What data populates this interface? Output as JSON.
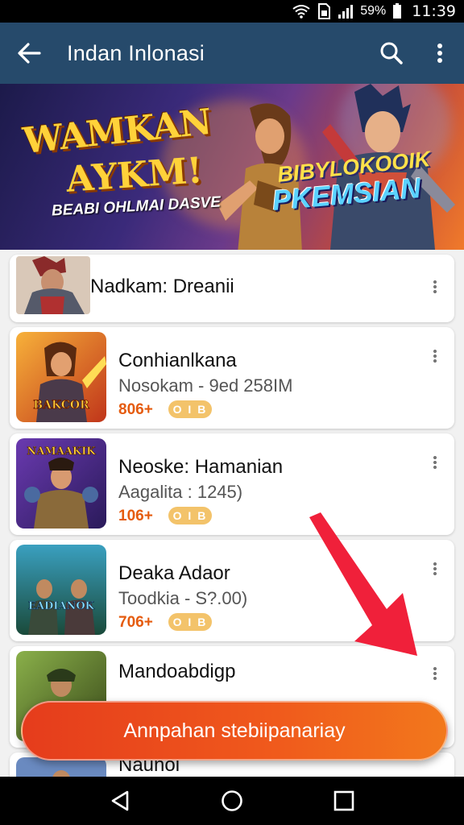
{
  "status_bar": {
    "battery_text": "59%",
    "time": "11:39",
    "icons": [
      "wifi-icon",
      "sim-icon",
      "signal-icon",
      "battery-icon"
    ]
  },
  "app_bar": {
    "title": "Indan Inlonasi",
    "back_icon": "arrow-left-icon",
    "search_icon": "search-icon",
    "more_icon": "more-vert-icon"
  },
  "banner": {
    "headline_line1": "WAMKAN",
    "headline_line2": "AYKM!",
    "subtitle": "BEABI OHLMAI DASVE",
    "brand_line1": "BIBYLOKOOIK",
    "brand_line2": "PKEMSIAN"
  },
  "list": {
    "items": [
      {
        "name": "Nadkam: Dreanii",
        "meta": "",
        "price": "",
        "pill": ""
      },
      {
        "name": "Conhianlkana",
        "meta": "Nosokam - 9ed 258IM",
        "price": "806+",
        "pill": "O I B",
        "thumb_caption": "BAKCOR"
      },
      {
        "name": "Neoske: Hamanian",
        "meta": "Aagalita : 1245)",
        "price": "106+",
        "pill": "O I B",
        "thumb_caption": "NAMAAKIK"
      },
      {
        "name": "Deaka Adaor",
        "meta": "Toodkia - S?.00)",
        "price": "706+",
        "pill": "O I B",
        "thumb_caption": "EADIANOK"
      },
      {
        "name": "Mandoabdigp",
        "meta": "",
        "price": "",
        "pill": ""
      },
      {
        "name": "Naunoi",
        "meta": "",
        "price": "",
        "pill": ""
      }
    ]
  },
  "cta": {
    "label": "Annpahan stebiipanariay"
  },
  "nav": {
    "icons": [
      "back-triangle-icon",
      "home-circle-icon",
      "recents-square-icon"
    ]
  },
  "colors": {
    "app_bar": "#264a6b",
    "accent_orange": "#f05a1c",
    "price": "#e55b0e",
    "pill": "#f3c36a",
    "pointer": "#f0203a"
  }
}
